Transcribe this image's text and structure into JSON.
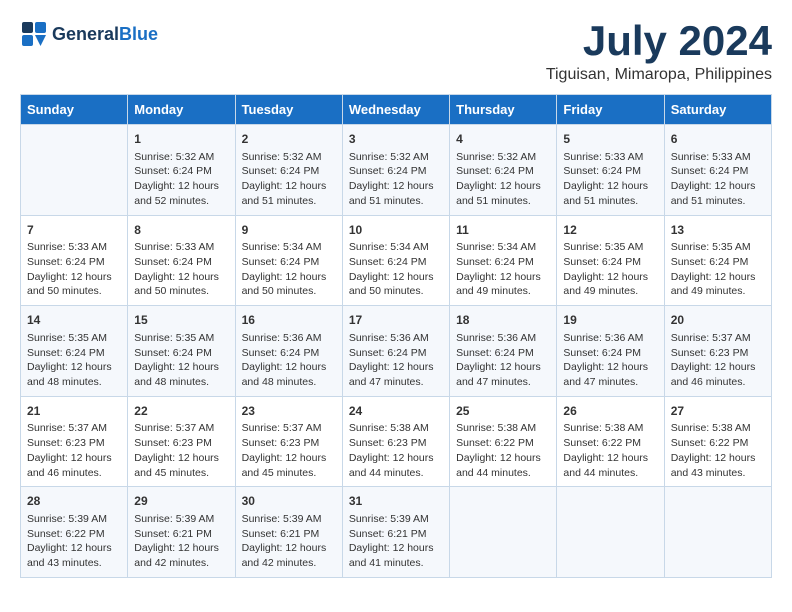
{
  "logo": {
    "general": "General",
    "blue": "Blue"
  },
  "title": "July 2024",
  "subtitle": "Tiguisan, Mimaropa, Philippines",
  "days": [
    "Sunday",
    "Monday",
    "Tuesday",
    "Wednesday",
    "Thursday",
    "Friday",
    "Saturday"
  ],
  "weeks": [
    [
      {
        "day": "",
        "info": ""
      },
      {
        "day": "1",
        "info": "Sunrise: 5:32 AM\nSunset: 6:24 PM\nDaylight: 12 hours\nand 52 minutes."
      },
      {
        "day": "2",
        "info": "Sunrise: 5:32 AM\nSunset: 6:24 PM\nDaylight: 12 hours\nand 51 minutes."
      },
      {
        "day": "3",
        "info": "Sunrise: 5:32 AM\nSunset: 6:24 PM\nDaylight: 12 hours\nand 51 minutes."
      },
      {
        "day": "4",
        "info": "Sunrise: 5:32 AM\nSunset: 6:24 PM\nDaylight: 12 hours\nand 51 minutes."
      },
      {
        "day": "5",
        "info": "Sunrise: 5:33 AM\nSunset: 6:24 PM\nDaylight: 12 hours\nand 51 minutes."
      },
      {
        "day": "6",
        "info": "Sunrise: 5:33 AM\nSunset: 6:24 PM\nDaylight: 12 hours\nand 51 minutes."
      }
    ],
    [
      {
        "day": "7",
        "info": "Sunrise: 5:33 AM\nSunset: 6:24 PM\nDaylight: 12 hours\nand 50 minutes."
      },
      {
        "day": "8",
        "info": "Sunrise: 5:33 AM\nSunset: 6:24 PM\nDaylight: 12 hours\nand 50 minutes."
      },
      {
        "day": "9",
        "info": "Sunrise: 5:34 AM\nSunset: 6:24 PM\nDaylight: 12 hours\nand 50 minutes."
      },
      {
        "day": "10",
        "info": "Sunrise: 5:34 AM\nSunset: 6:24 PM\nDaylight: 12 hours\nand 50 minutes."
      },
      {
        "day": "11",
        "info": "Sunrise: 5:34 AM\nSunset: 6:24 PM\nDaylight: 12 hours\nand 49 minutes."
      },
      {
        "day": "12",
        "info": "Sunrise: 5:35 AM\nSunset: 6:24 PM\nDaylight: 12 hours\nand 49 minutes."
      },
      {
        "day": "13",
        "info": "Sunrise: 5:35 AM\nSunset: 6:24 PM\nDaylight: 12 hours\nand 49 minutes."
      }
    ],
    [
      {
        "day": "14",
        "info": "Sunrise: 5:35 AM\nSunset: 6:24 PM\nDaylight: 12 hours\nand 48 minutes."
      },
      {
        "day": "15",
        "info": "Sunrise: 5:35 AM\nSunset: 6:24 PM\nDaylight: 12 hours\nand 48 minutes."
      },
      {
        "day": "16",
        "info": "Sunrise: 5:36 AM\nSunset: 6:24 PM\nDaylight: 12 hours\nand 48 minutes."
      },
      {
        "day": "17",
        "info": "Sunrise: 5:36 AM\nSunset: 6:24 PM\nDaylight: 12 hours\nand 47 minutes."
      },
      {
        "day": "18",
        "info": "Sunrise: 5:36 AM\nSunset: 6:24 PM\nDaylight: 12 hours\nand 47 minutes."
      },
      {
        "day": "19",
        "info": "Sunrise: 5:36 AM\nSunset: 6:24 PM\nDaylight: 12 hours\nand 47 minutes."
      },
      {
        "day": "20",
        "info": "Sunrise: 5:37 AM\nSunset: 6:23 PM\nDaylight: 12 hours\nand 46 minutes."
      }
    ],
    [
      {
        "day": "21",
        "info": "Sunrise: 5:37 AM\nSunset: 6:23 PM\nDaylight: 12 hours\nand 46 minutes."
      },
      {
        "day": "22",
        "info": "Sunrise: 5:37 AM\nSunset: 6:23 PM\nDaylight: 12 hours\nand 45 minutes."
      },
      {
        "day": "23",
        "info": "Sunrise: 5:37 AM\nSunset: 6:23 PM\nDaylight: 12 hours\nand 45 minutes."
      },
      {
        "day": "24",
        "info": "Sunrise: 5:38 AM\nSunset: 6:23 PM\nDaylight: 12 hours\nand 44 minutes."
      },
      {
        "day": "25",
        "info": "Sunrise: 5:38 AM\nSunset: 6:22 PM\nDaylight: 12 hours\nand 44 minutes."
      },
      {
        "day": "26",
        "info": "Sunrise: 5:38 AM\nSunset: 6:22 PM\nDaylight: 12 hours\nand 44 minutes."
      },
      {
        "day": "27",
        "info": "Sunrise: 5:38 AM\nSunset: 6:22 PM\nDaylight: 12 hours\nand 43 minutes."
      }
    ],
    [
      {
        "day": "28",
        "info": "Sunrise: 5:39 AM\nSunset: 6:22 PM\nDaylight: 12 hours\nand 43 minutes."
      },
      {
        "day": "29",
        "info": "Sunrise: 5:39 AM\nSunset: 6:21 PM\nDaylight: 12 hours\nand 42 minutes."
      },
      {
        "day": "30",
        "info": "Sunrise: 5:39 AM\nSunset: 6:21 PM\nDaylight: 12 hours\nand 42 minutes."
      },
      {
        "day": "31",
        "info": "Sunrise: 5:39 AM\nSunset: 6:21 PM\nDaylight: 12 hours\nand 41 minutes."
      },
      {
        "day": "",
        "info": ""
      },
      {
        "day": "",
        "info": ""
      },
      {
        "day": "",
        "info": ""
      }
    ]
  ]
}
